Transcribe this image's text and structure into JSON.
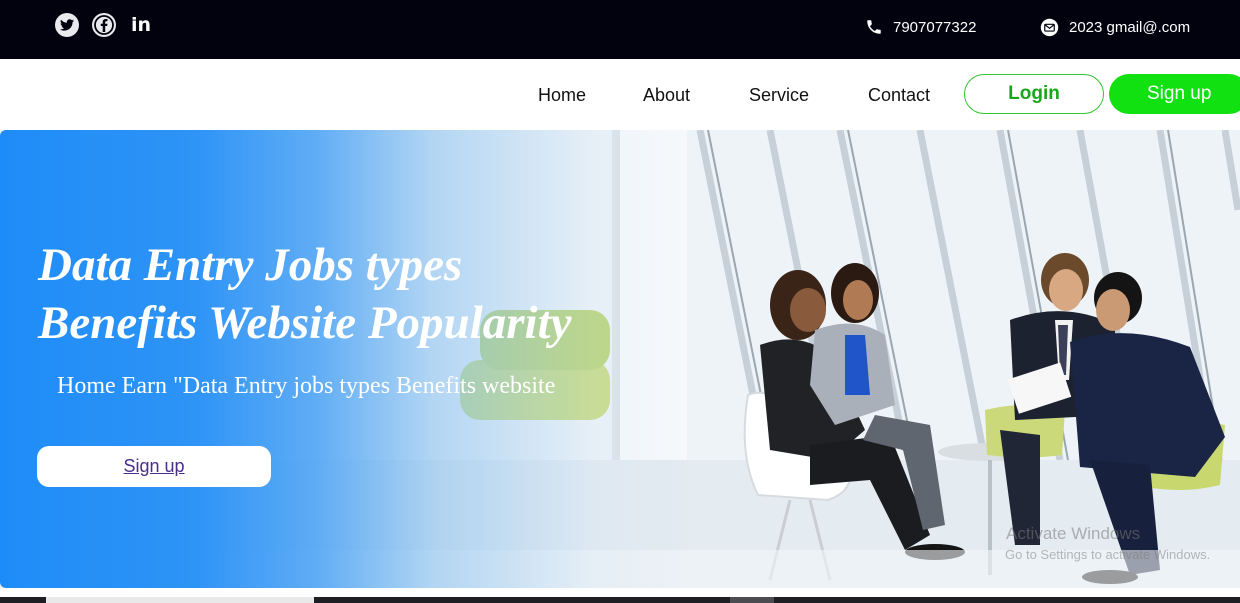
{
  "topbar": {
    "social": [
      {
        "name": "twitter-icon"
      },
      {
        "name": "facebook-icon"
      },
      {
        "name": "linkedin-icon",
        "label": "in"
      }
    ],
    "phone": "7907077322",
    "email": "2023 gmail@.com"
  },
  "nav": {
    "links": [
      "Home",
      "About",
      "Service",
      "Contact"
    ],
    "login_label": "Login",
    "signup_label": "Sign up"
  },
  "hero": {
    "title_line1": "Data Entry Jobs types",
    "title_line2": "Benefits Website Popularity",
    "subtitle": "Home Earn \"Data Entry jobs types Benefits website",
    "button_label": "Sign up",
    "watermark_line1": "Activate Windows",
    "watermark_line2": "Go to Settings to activate Windows."
  },
  "colors": {
    "topbar_bg": "#02020f",
    "accent_green": "#11e011",
    "hero_blue": "#1e8cf8"
  }
}
